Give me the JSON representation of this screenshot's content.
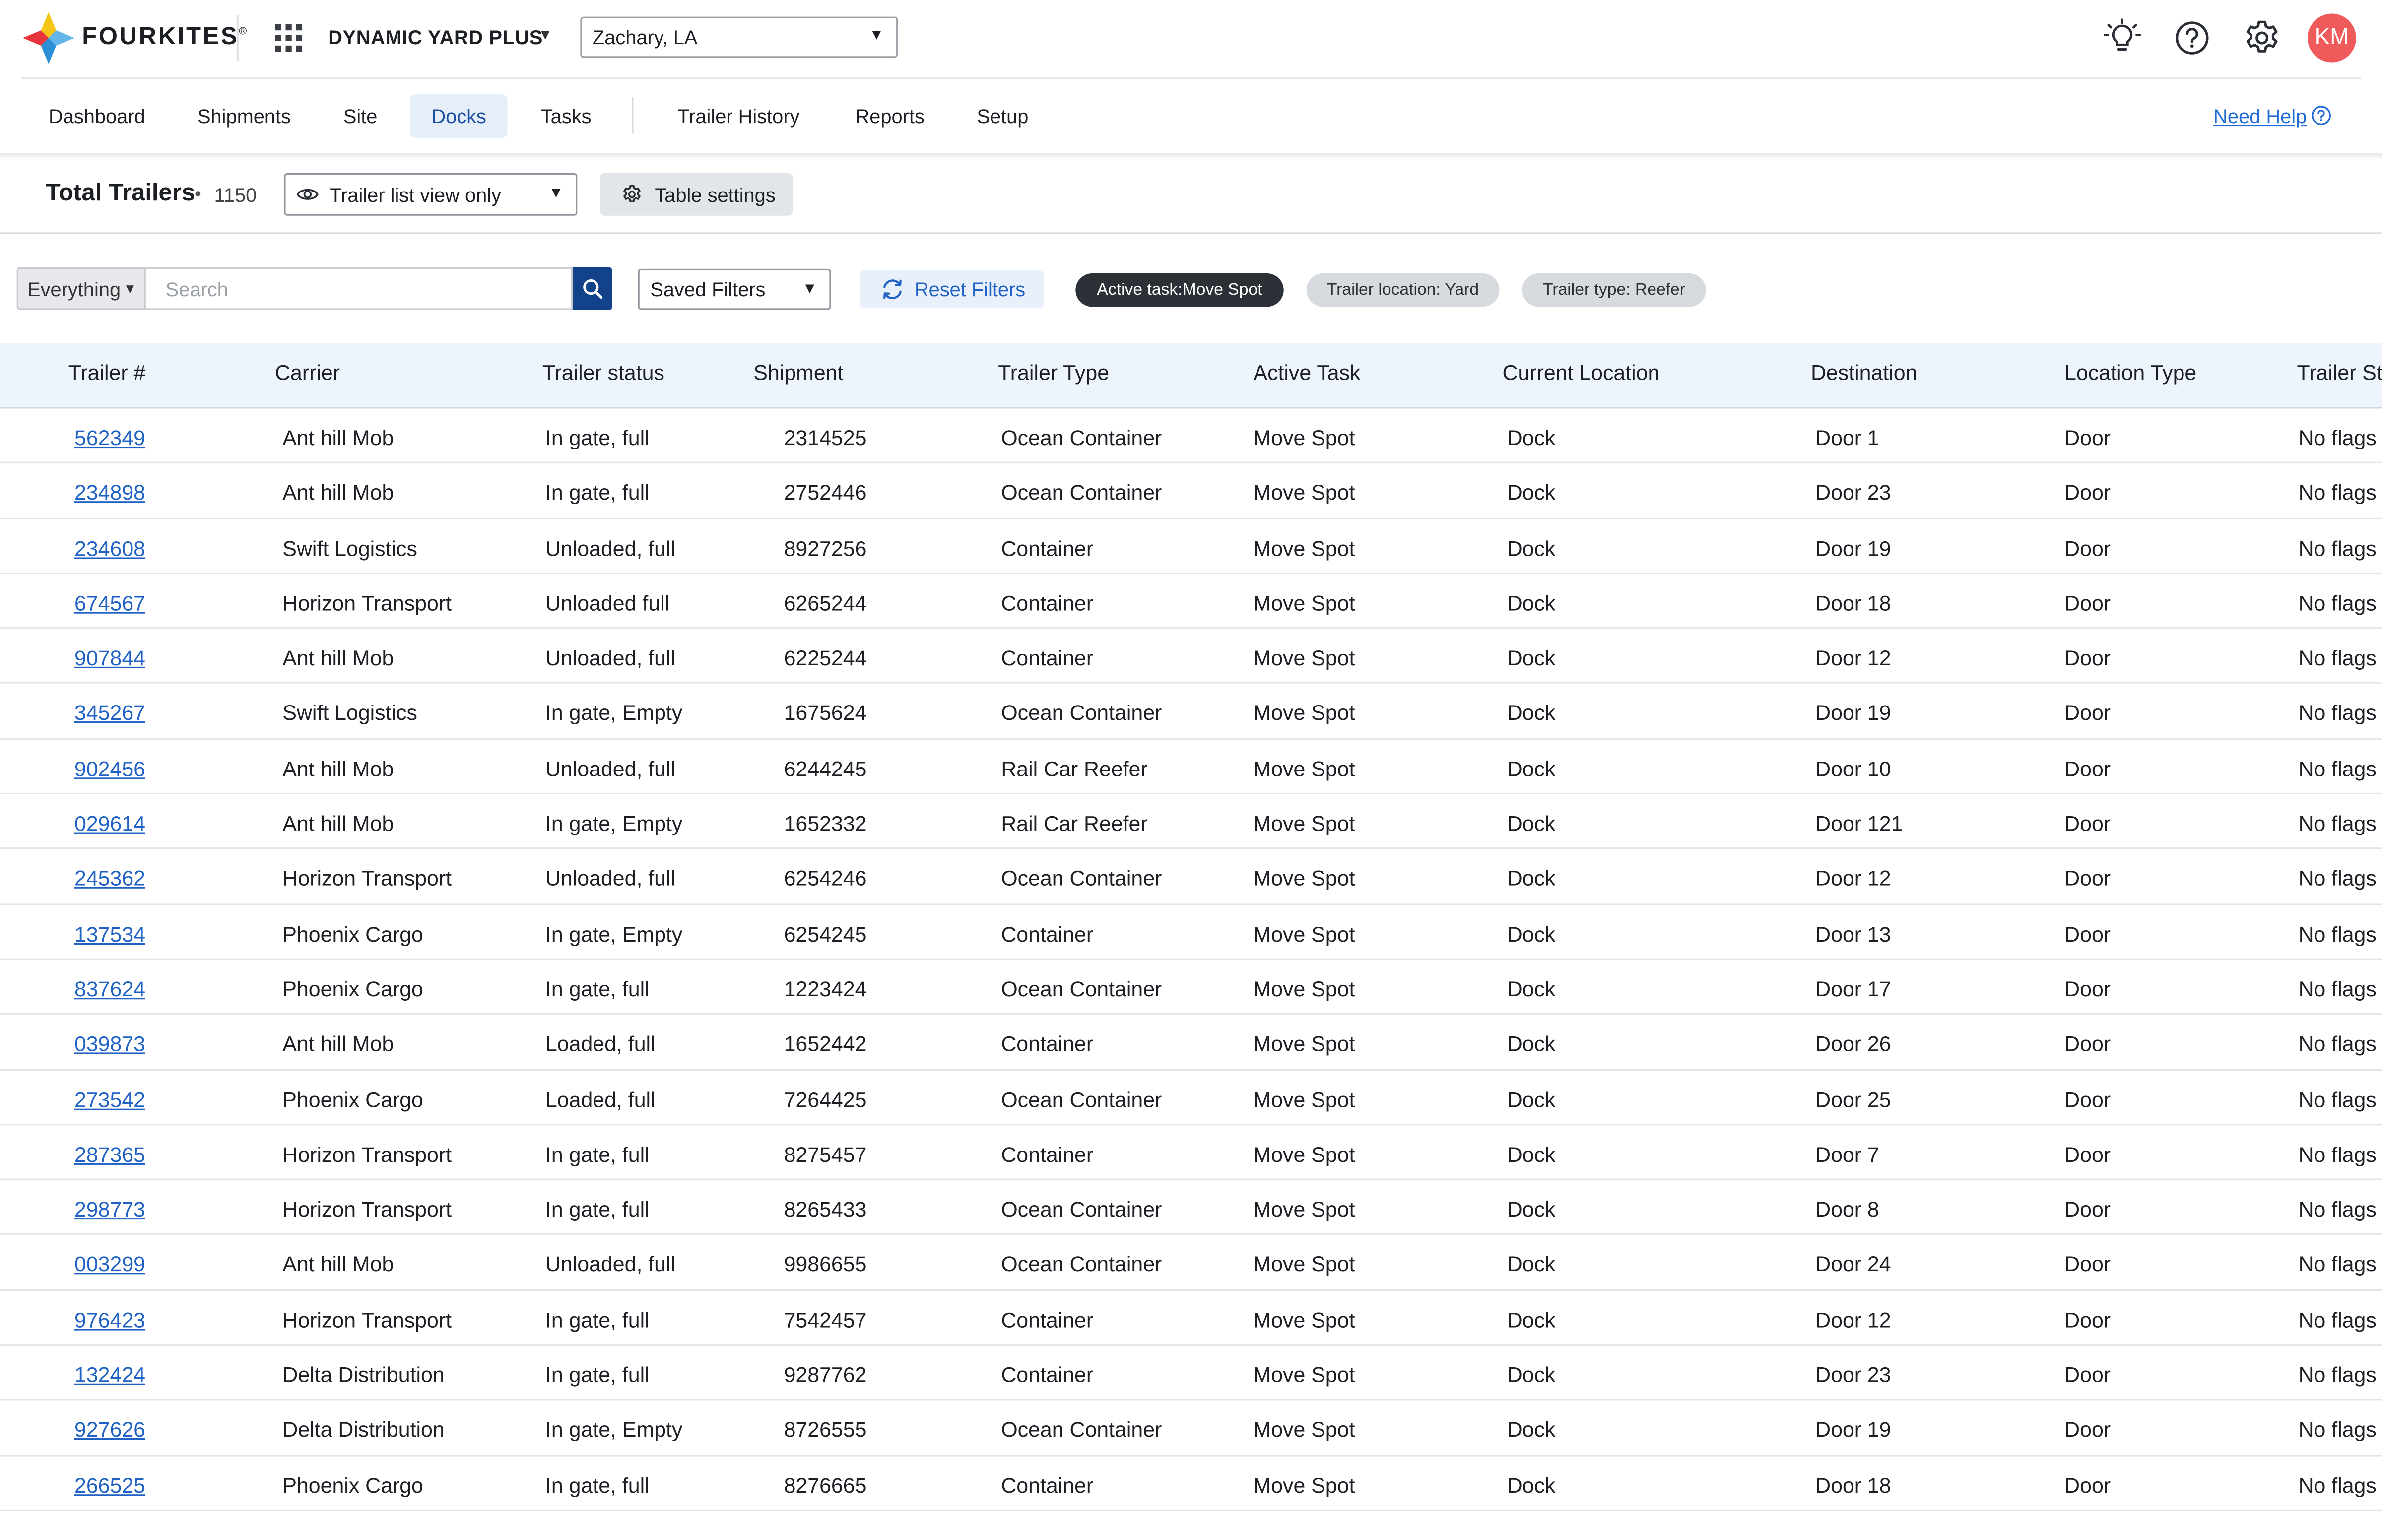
{
  "header": {
    "brand": "FOURKITES",
    "brand_mark": "®",
    "app_name": "DYNAMIC YARD PLUS",
    "location": "Zachary, LA",
    "user_initials": "KM",
    "icons": [
      "apps-grid-icon",
      "lightbulb-icon",
      "help-circle-icon",
      "gear-icon"
    ],
    "colors": {
      "avatar": "#ef5b5b",
      "accent": "#1f62c4",
      "search_button": "#12428a"
    }
  },
  "nav": {
    "items": [
      {
        "label": "Dashboard"
      },
      {
        "label": "Shipments"
      },
      {
        "label": "Site"
      },
      {
        "label": "Docks",
        "active": true
      },
      {
        "label": "Tasks"
      },
      {
        "label": "Trailer History"
      },
      {
        "label": "Reports"
      },
      {
        "label": "Setup"
      }
    ],
    "help_label": "Need Help"
  },
  "toolbar": {
    "title": "Total Trailers",
    "count_separator": "•",
    "count": "1150",
    "view_select": "Trailer list view only",
    "table_settings_label": "Table settings"
  },
  "filters": {
    "scope": "Everything",
    "search_placeholder": "Search",
    "saved_filters": "Saved Filters",
    "reset_label": "Reset Filters",
    "chips": [
      {
        "label": "Active task:Move Spot",
        "style": "dark"
      },
      {
        "label": "Trailer location: Yard",
        "style": "light"
      },
      {
        "label": "Trailer type: Reefer",
        "style": "light"
      }
    ]
  },
  "table": {
    "columns": [
      "Trailer #",
      "Carrier",
      "Trailer status",
      "Shipment",
      "Trailer Type",
      "Active Task",
      "Current Location",
      "Destination",
      "Location Type",
      "Trailer St"
    ],
    "rows": [
      [
        "562349",
        "Ant hill Mob",
        "In gate, full",
        "2314525",
        "Ocean Container",
        "Move Spot",
        "Dock",
        "Door 1",
        "Door",
        "No flags"
      ],
      [
        "234898",
        "Ant hill Mob",
        "In gate, full",
        "2752446",
        "Ocean Container",
        "Move Spot",
        "Dock",
        "Door 23",
        "Door",
        "No flags"
      ],
      [
        "234608",
        "Swift Logistics",
        "Unloaded, full",
        "8927256",
        "Container",
        "Move Spot",
        "Dock",
        "Door 19",
        "Door",
        "No flags"
      ],
      [
        "674567",
        "Horizon Transport",
        "Unloaded full",
        "6265244",
        "Container",
        "Move Spot",
        "Dock",
        "Door 18",
        "Door",
        "No flags"
      ],
      [
        "907844",
        "Ant hill Mob",
        "Unloaded, full",
        "6225244",
        "Container",
        "Move Spot",
        "Dock",
        "Door 12",
        "Door",
        "No flags"
      ],
      [
        "345267",
        "Swift Logistics",
        "In gate, Empty",
        "1675624",
        "Ocean Container",
        "Move Spot",
        "Dock",
        "Door 19",
        "Door",
        "No flags"
      ],
      [
        "902456",
        "Ant hill Mob",
        "Unloaded, full",
        "6244245",
        "Rail Car Reefer",
        "Move Spot",
        "Dock",
        "Door 10",
        "Door",
        "No flags"
      ],
      [
        "029614",
        "Ant hill Mob",
        "In gate, Empty",
        "1652332",
        "Rail Car Reefer",
        "Move Spot",
        "Dock",
        "Door 121",
        "Door",
        "No flags"
      ],
      [
        "245362",
        "Horizon Transport",
        "Unloaded, full",
        "6254246",
        "Ocean Container",
        "Move Spot",
        "Dock",
        "Door 12",
        "Door",
        "No flags"
      ],
      [
        "137534",
        "Phoenix Cargo",
        "In gate, Empty",
        "6254245",
        "Container",
        "Move Spot",
        "Dock",
        "Door 13",
        "Door",
        "No flags"
      ],
      [
        "837624",
        "Phoenix Cargo",
        "In gate, full",
        "1223424",
        "Ocean Container",
        "Move Spot",
        "Dock",
        "Door 17",
        "Door",
        "No flags"
      ],
      [
        "039873",
        "Ant hill Mob",
        "Loaded, full",
        "1652442",
        "Container",
        "Move Spot",
        "Dock",
        "Door 26",
        "Door",
        "No flags"
      ],
      [
        "273542",
        "Phoenix Cargo",
        "Loaded, full",
        "7264425",
        "Ocean Container",
        "Move Spot",
        "Dock",
        "Door 25",
        "Door",
        "No flags"
      ],
      [
        "287365",
        "Horizon Transport",
        "In gate, full",
        "8275457",
        "Container",
        "Move Spot",
        "Dock",
        "Door 7",
        "Door",
        "No flags"
      ],
      [
        "298773",
        "Horizon Transport",
        "In gate, full",
        "8265433",
        "Ocean Container",
        "Move Spot",
        "Dock",
        "Door 8",
        "Door",
        "No flags"
      ],
      [
        "003299",
        "Ant hill Mob",
        "Unloaded, full",
        "9986655",
        "Ocean Container",
        "Move Spot",
        "Dock",
        "Door 24",
        "Door",
        "No flags"
      ],
      [
        "976423",
        "Horizon Transport",
        "In gate, full",
        "7542457",
        "Container",
        "Move Spot",
        "Dock",
        "Door 12",
        "Door",
        "No flags"
      ],
      [
        "132424",
        "Delta Distribution",
        "In gate, full",
        "9287762",
        "Container",
        "Move Spot",
        "Dock",
        "Door 23",
        "Door",
        "No flags"
      ],
      [
        "927626",
        "Delta Distribution",
        "In gate, Empty",
        "8726555",
        "Ocean Container",
        "Move Spot",
        "Dock",
        "Door 19",
        "Door",
        "No flags"
      ],
      [
        "266525",
        "Phoenix Cargo",
        "In gate, full",
        "8276665",
        "Container",
        "Move Spot",
        "Dock",
        "Door 18",
        "Door",
        "No flags"
      ]
    ]
  }
}
